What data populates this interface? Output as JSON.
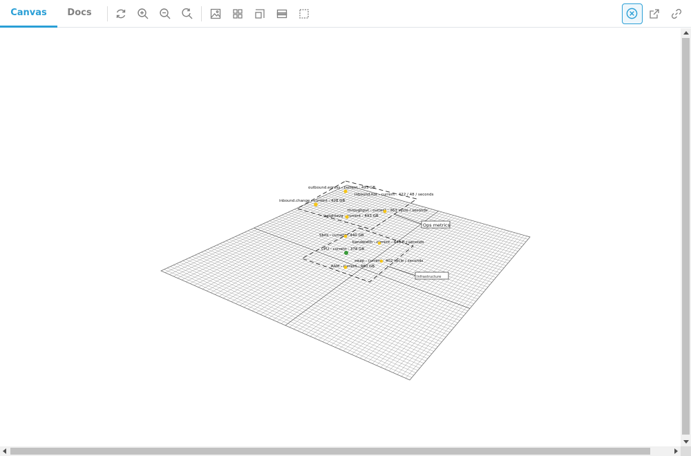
{
  "tabs": [
    {
      "label": "Canvas",
      "active": true
    },
    {
      "label": "Docs",
      "active": false
    }
  ],
  "toolbar_icons": [
    "refresh-icon",
    "zoom-in-icon",
    "zoom-out-icon",
    "zoom-reset-icon",
    "image-icon",
    "grid-icon",
    "layout-icon",
    "panel-icon",
    "selection-icon",
    "close-circle-icon",
    "external-link-icon",
    "link-icon"
  ],
  "colors": {
    "accent": "#2a9fd6",
    "mesh": "#8a8a8a",
    "node_warning": "#f5c518",
    "node_ok": "#3a9a3a"
  },
  "scene": {
    "labels": [
      "outbound.egress - current : 493 GB",
      "inbound.hot - current : 422 / 48 / seconds",
      "inbound.change - current : 428 GB",
      "throughput - current : 363 cycle / seconds",
      "weightavg - current : 493 GB",
      "Sbits - current : 440 GB",
      "bandwidth - current : 440 B / seconds",
      "CPU - current : 378 GB",
      "swap - current : 402 cycle / seconds",
      "RAM - current : 480 GB"
    ],
    "region_labels": [
      "Ops metrics",
      "Infrastructure"
    ]
  }
}
